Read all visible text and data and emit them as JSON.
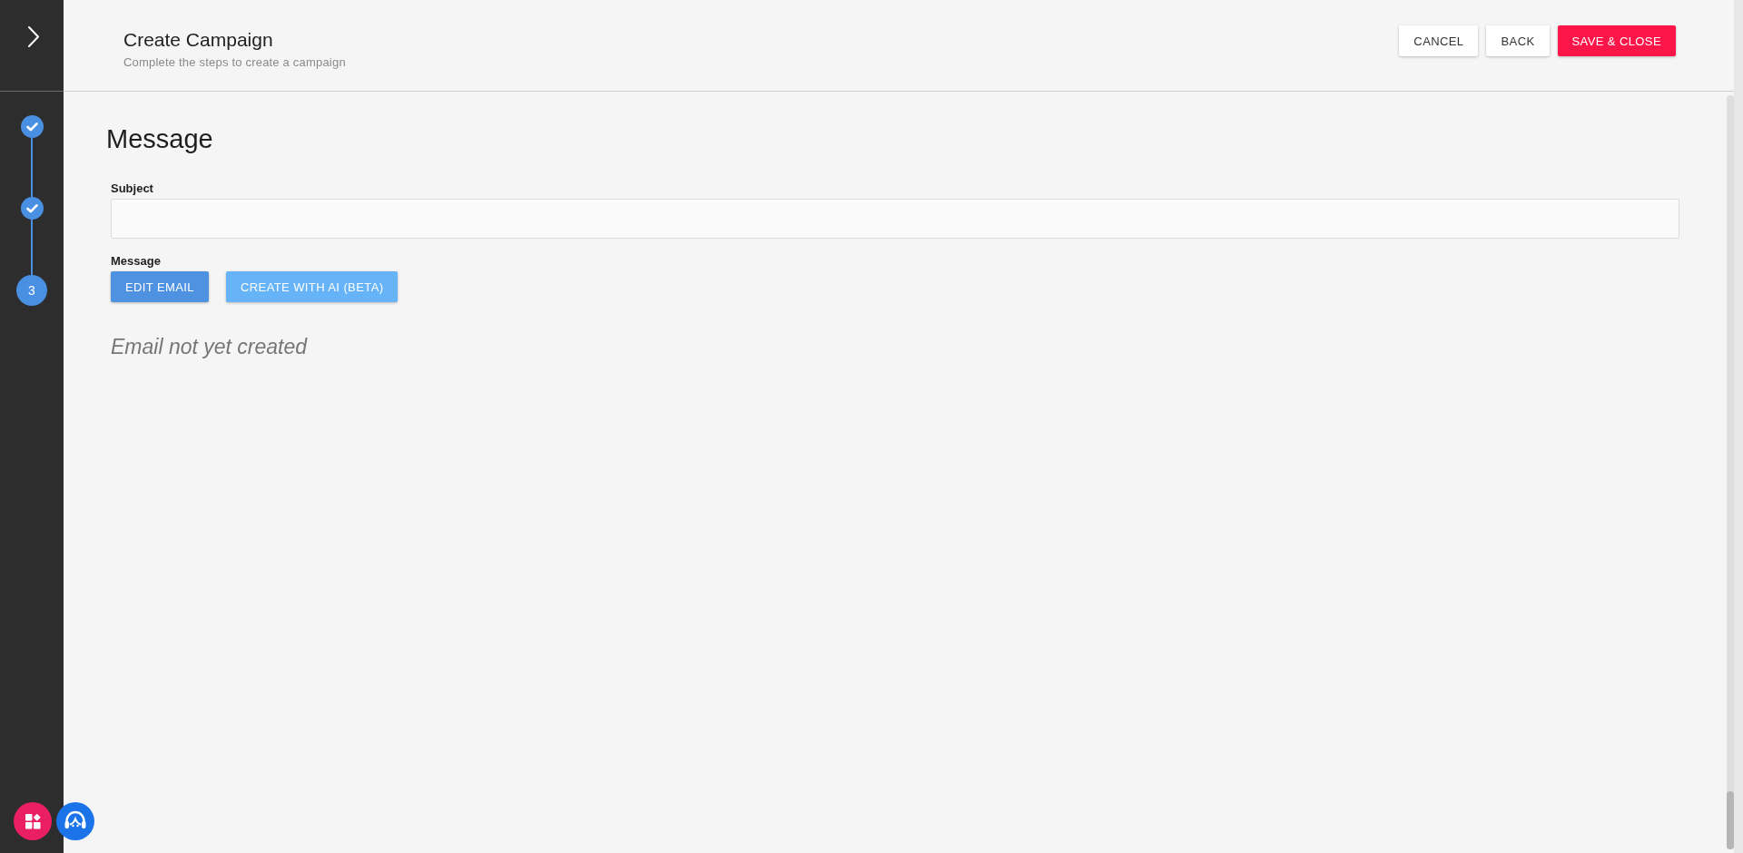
{
  "sidebar": {
    "steps": [
      {
        "done": true,
        "selected": false
      },
      {
        "done": true,
        "selected": false
      },
      {
        "number": "3",
        "done": false,
        "selected": true
      }
    ]
  },
  "header": {
    "title": "Create Campaign",
    "subtitle": "Complete the steps to create a campaign",
    "buttons": [
      {
        "label": "CANCEL",
        "kind": "outlined"
      },
      {
        "label": "BACK",
        "kind": "outlined"
      },
      {
        "label": "SAVE & CLOSE",
        "kind": "danger"
      }
    ]
  },
  "content": {
    "heading": "Message",
    "subject": {
      "label": "Subject"
    },
    "message": {
      "label": "Message",
      "buttons": [
        {
          "label": "EDIT EMAIL",
          "hovered": false
        },
        {
          "label": "CREATE WITH AI (BETA)",
          "hovered": true
        }
      ],
      "status": "Email not yet created"
    }
  }
}
